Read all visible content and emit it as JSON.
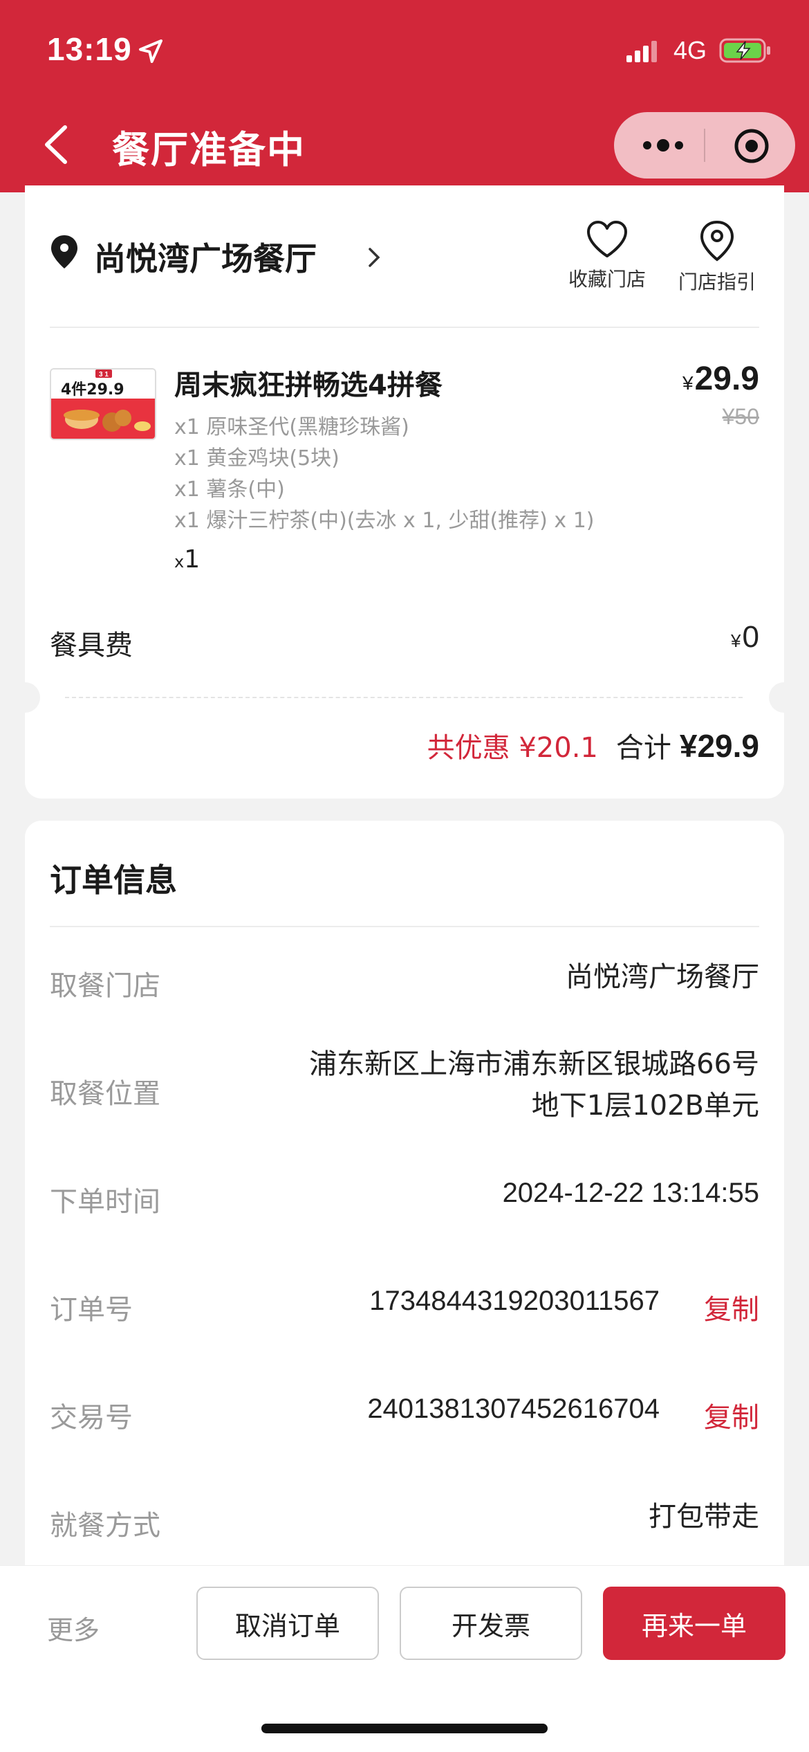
{
  "status_bar": {
    "time": "13:19",
    "network": "4G"
  },
  "header": {
    "title": "餐厅准备中"
  },
  "store": {
    "name": "尚悦湾广场餐厅",
    "favorite_label": "收藏门店",
    "guide_label": "门店指引"
  },
  "order_item": {
    "thumb_text": "4件29.9",
    "thumb_badge": "3 1",
    "name": "周末疯狂拼畅选4拼餐",
    "price_symbol": "¥",
    "price": "29.9",
    "original_price": "¥50",
    "components": [
      "x1 原味圣代(黑糖珍珠酱)",
      "x1 黄金鸡块(5块)",
      "x1 薯条(中)",
      "x1 爆汁三柠茶(中)(去冰 x 1, 少甜(推荐) x 1)"
    ],
    "qty_prefix": "x",
    "qty": "1"
  },
  "tableware": {
    "label": "餐具费",
    "symbol": "¥",
    "value": "0"
  },
  "totals": {
    "discount": "共优惠 ¥20.1",
    "total_label": "合计",
    "total_value": "¥29.9"
  },
  "order_info": {
    "title": "订单信息",
    "pickup_store_label": "取餐门店",
    "pickup_store_value": "尚悦湾广场餐厅",
    "pickup_location_label": "取餐位置",
    "pickup_location_line1": "浦东新区上海市浦东新区银城路66号",
    "pickup_location_line2": "地下1层102B单元",
    "order_time_label": "下单时间",
    "order_time_value": "2024-12-22 13:14:55",
    "order_no_label": "订单号",
    "order_no_value": "1734844319203011567",
    "trade_no_label": "交易号",
    "trade_no_value": "2401381307452616704",
    "copy_label": "复制",
    "dining_label": "就餐方式",
    "dining_value": "打包带走"
  },
  "bottom_bar": {
    "more": "更多",
    "cancel": "取消订单",
    "invoice": "开发票",
    "reorder": "再来一单"
  },
  "colors": {
    "brand_red": "#d2273a",
    "background": "#f2f2f2"
  }
}
